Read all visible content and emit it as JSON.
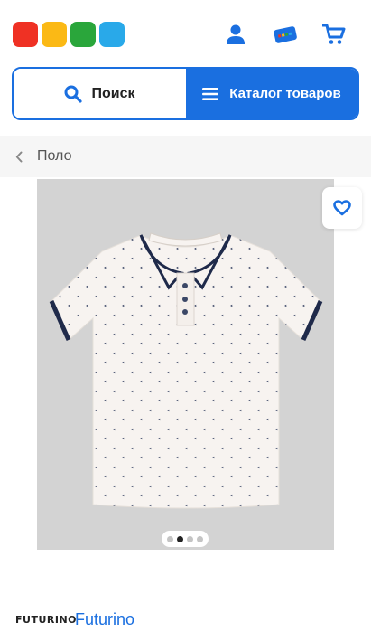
{
  "header": {
    "logo_colors": [
      "#ef3124",
      "#fbb915",
      "#2aa63b",
      "#29a9e9"
    ],
    "accent": "#1a6fe0",
    "icons": [
      "user-icon",
      "loyalty-card-icon",
      "cart-icon"
    ]
  },
  "search_bar": {
    "search_label": "Поиск",
    "catalog_label": "Каталог товаров"
  },
  "breadcrumb": {
    "label": "Поло"
  },
  "product": {
    "image_alt_icon": "polo-shirt-image",
    "gallery_count": 4,
    "gallery_active_index": 1
  },
  "brand": {
    "logo_text": "FUTURINO",
    "name": "Futurino"
  }
}
